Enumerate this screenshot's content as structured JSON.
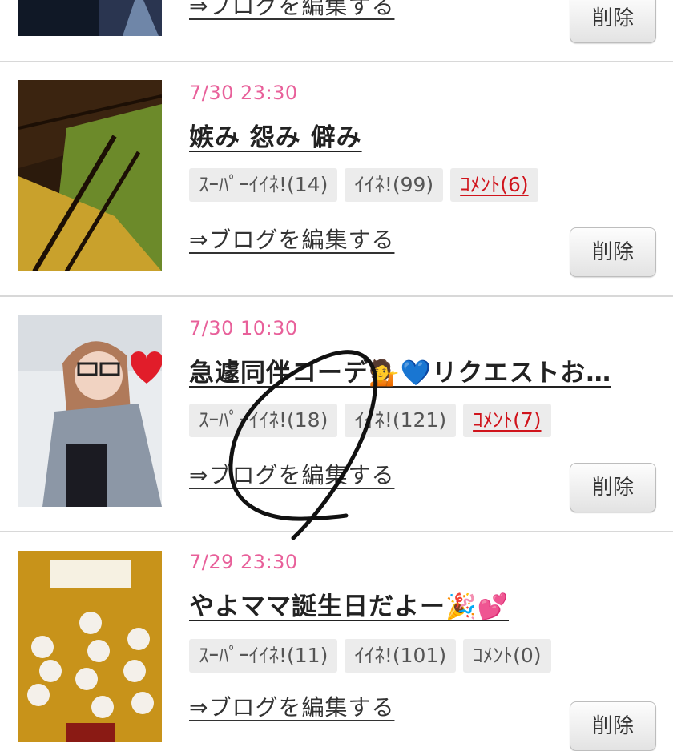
{
  "entries": [
    {
      "date": "",
      "title": "",
      "badges": [],
      "edit_label": "⇒ブログを編集する",
      "delete_label": "削除"
    },
    {
      "date": "7/30 23:30",
      "title": "嫉み 怨み 僻み",
      "badges": [
        "ｽｰﾊﾟｰｲｲﾈ!(14)",
        "ｲｲﾈ!(99)",
        "ｺﾒﾝﾄ(6)"
      ],
      "edit_label": "⇒ブログを編集する",
      "delete_label": "削除"
    },
    {
      "date": "7/30 10:30",
      "title": "急遽同伴コーデ💁💙リクエストお…",
      "badges": [
        "ｽｰﾊﾟｰｲｲﾈ!(18)",
        "ｲｲﾈ!(121)",
        "ｺﾒﾝﾄ(7)"
      ],
      "edit_label": "⇒ブログを編集する",
      "delete_label": "削除"
    },
    {
      "date": "7/29 23:30",
      "title": "やよママ誕生日だよー🎉💕",
      "badges": [
        "ｽｰﾊﾟｰｲｲﾈ!(11)",
        "ｲｲﾈ!(101)",
        "ｺﾒﾝﾄ(0)"
      ],
      "edit_label": "⇒ブログを編集する",
      "delete_label": "削除"
    }
  ],
  "thumbnails": [
    {
      "name": "entry-0-thumbnail",
      "colors": [
        "#101826",
        "#2a3550",
        "#6f86a8"
      ]
    },
    {
      "name": "entry-1-thumbnail",
      "colors": [
        "#3b2410",
        "#c9a12c",
        "#6c8a2a"
      ]
    },
    {
      "name": "entry-2-thumbnail",
      "colors": [
        "#e9ecef",
        "#b07a5a",
        "#8c97a6"
      ]
    },
    {
      "name": "entry-3-thumbnail",
      "colors": [
        "#c8931a",
        "#f4f0ea",
        "#8a1a14"
      ]
    }
  ],
  "colors": {
    "date": "#e8609a",
    "comment_link": "#d0141c",
    "divider": "#d8d8d8"
  }
}
